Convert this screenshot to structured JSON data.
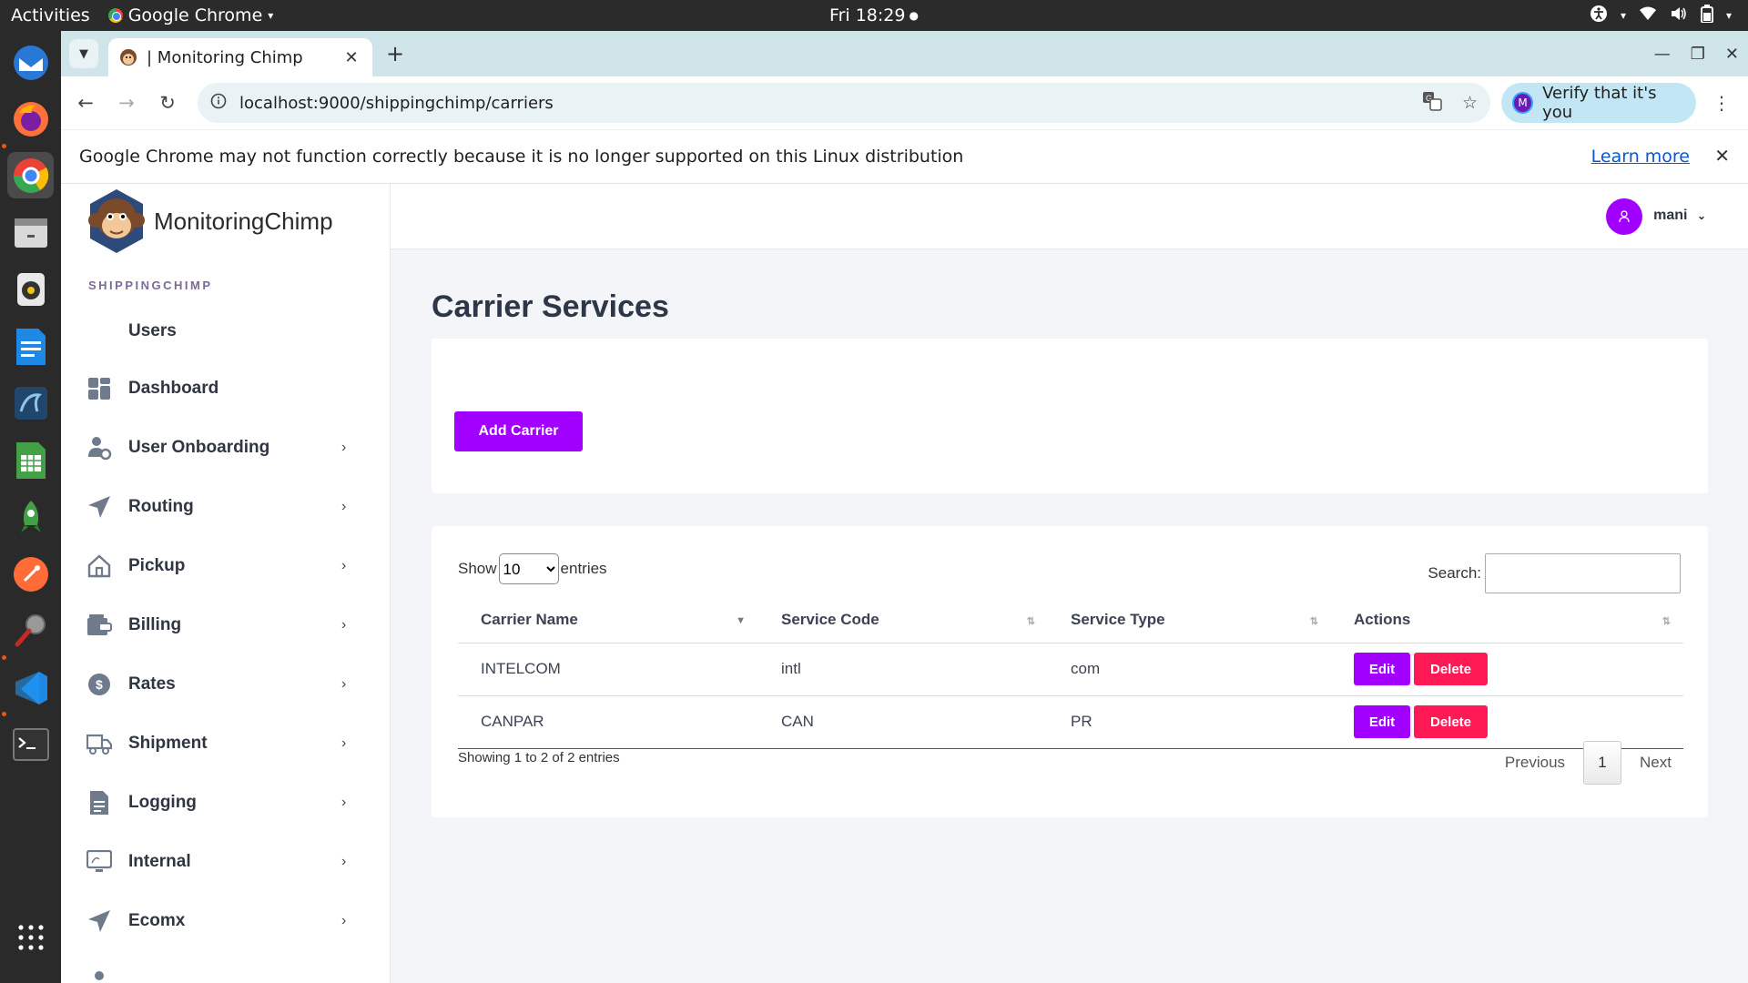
{
  "os": {
    "activities": "Activities",
    "app_name": "Google Chrome",
    "clock": "Fri 18:29"
  },
  "browser": {
    "tab_title": "| Monitoring Chimp",
    "url": "localhost:9000/shippingchimp/carriers",
    "verify_label": "Verify that it's you",
    "infobar_text": "Google Chrome may not function correctly because it is no longer supported on this Linux distribution",
    "infobar_link": "Learn more"
  },
  "app": {
    "brand": "MonitoringChimp",
    "section_label": "SHIPPINGCHIMP",
    "user_name": "mani",
    "accent_color": "#a100ff",
    "danger_color": "#ff1a55"
  },
  "sidebar": {
    "items": [
      {
        "label": "Users",
        "icon": "none"
      },
      {
        "label": "Dashboard",
        "icon": "grid-icon"
      },
      {
        "label": "User Onboarding",
        "icon": "user-gear-icon"
      },
      {
        "label": "Routing",
        "icon": "paper-plane-icon"
      },
      {
        "label": "Pickup",
        "icon": "home-icon"
      },
      {
        "label": "Billing",
        "icon": "wallet-icon"
      },
      {
        "label": "Rates",
        "icon": "dollar-icon"
      },
      {
        "label": "Shipment",
        "icon": "truck-icon"
      },
      {
        "label": "Logging",
        "icon": "document-icon"
      },
      {
        "label": "Internal",
        "icon": "monitor-icon"
      },
      {
        "label": "Ecomx",
        "icon": "paper-plane-icon"
      }
    ]
  },
  "main": {
    "title": "Carrier Services",
    "add_button": "Add Carrier",
    "show_label": "Show",
    "entries_label": "entries",
    "page_length": "10",
    "search_label": "Search:",
    "columns": [
      "Carrier Name",
      "Service Code",
      "Service Type",
      "Actions"
    ],
    "rows": [
      {
        "carrier": "INTELCOM",
        "code": "intl",
        "type": "com"
      },
      {
        "carrier": "CANPAR",
        "code": "CAN",
        "type": "PR"
      }
    ],
    "edit_label": "Edit",
    "delete_label": "Delete",
    "info": "Showing 1 to 2 of 2 entries",
    "previous": "Previous",
    "current_page": "1",
    "next": "Next"
  }
}
